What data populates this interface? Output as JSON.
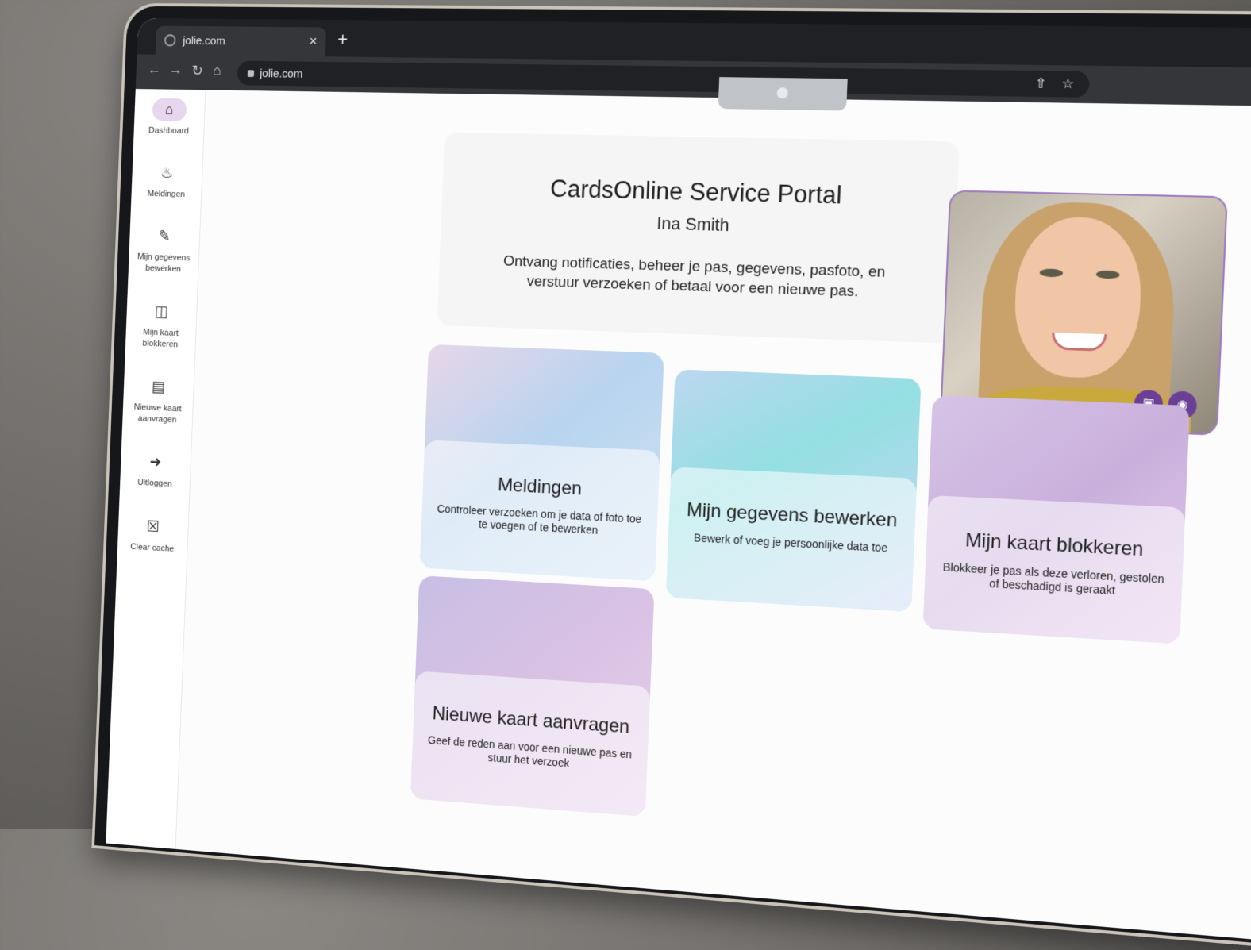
{
  "browser": {
    "tab_title": "jolie.com",
    "url": "jolie.com",
    "close_glyph": "×",
    "newtab_glyph": "+"
  },
  "sidebar": {
    "items": [
      {
        "label": "Dashboard",
        "icon": "home-icon"
      },
      {
        "label": "Meldingen",
        "icon": "bell-icon"
      },
      {
        "label": "Mijn gegevens bewerken",
        "icon": "pencil-icon"
      },
      {
        "label": "Mijn kaart blokkeren",
        "icon": "card-off-icon"
      },
      {
        "label": "Nieuwe kaart aanvragen",
        "icon": "id-card-icon"
      },
      {
        "label": "Uitloggen",
        "icon": "logout-icon"
      },
      {
        "label": "Clear cache",
        "icon": "trash-icon"
      }
    ]
  },
  "hero": {
    "title": "CardsOnline Service Portal",
    "user": "Ina Smith",
    "description": "Ontvang notificaties, beheer je pas, gegevens, pasfoto, en verstuur verzoeken of betaal voor een nieuwe pas."
  },
  "cards": [
    {
      "title": "Meldingen",
      "subtitle": "Controleer verzoeken om je data of foto toe te voegen of te bewerken"
    },
    {
      "title": "Mijn gegevens bewerken",
      "subtitle": "Bewerk of voeg je persoonlijke data toe"
    },
    {
      "title": "Mijn kaart blokkeren",
      "subtitle": "Blokkeer je pas als deze verloren, gestolen of beschadigd is geraakt"
    },
    {
      "title": "Nieuwe kaart aanvragen",
      "subtitle": "Geef de reden aan voor een nieuwe pas en stuur het verzoek"
    }
  ],
  "colors": {
    "accent": "#6b3f94",
    "active_nav": "#e6d6ee",
    "photo_border": "#9f7cc0"
  }
}
